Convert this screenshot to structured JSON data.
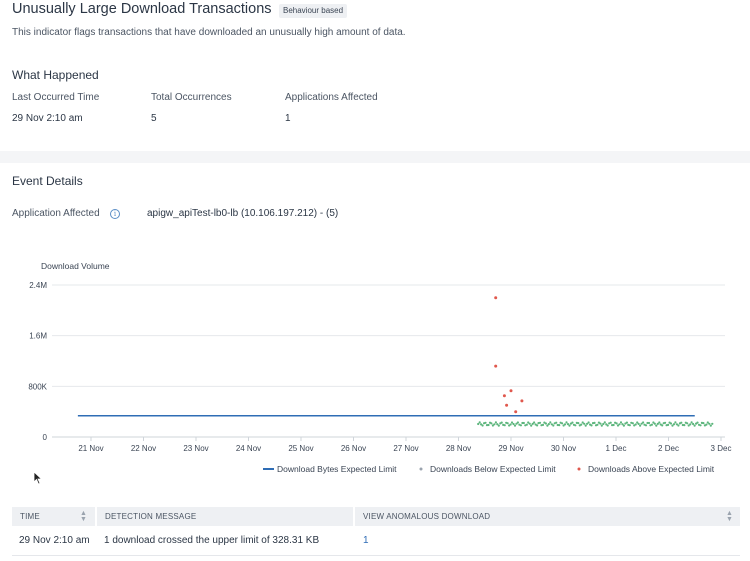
{
  "indicator": {
    "title": "Unusually Large Download Transactions",
    "badge": "Behaviour based",
    "description": "This indicator flags transactions that have downloaded an unusually high amount of data."
  },
  "what_happened": {
    "title": "What Happened",
    "stats": [
      {
        "label": "Last Occurred Time",
        "value": "29 Nov 2:10 am"
      },
      {
        "label": "Total Occurrences",
        "value": "5"
      },
      {
        "label": "Applications Affected",
        "value": "1"
      }
    ]
  },
  "event_details": {
    "title": "Event Details",
    "app_label": "Application Affected",
    "app_value": "apigw_apiTest-lb0-lb (10.106.197.212) - (5)"
  },
  "chart_data": {
    "type": "scatter",
    "ylabel": "Download Volume",
    "y_ticks": [
      "2.4M",
      "1.6M",
      "800K",
      "0"
    ],
    "y_tick_values": [
      2400000,
      1600000,
      800000,
      0
    ],
    "ylim": [
      0,
      2400000
    ],
    "x_ticks": [
      "21 Nov",
      "22 Nov",
      "23 Nov",
      "24 Nov",
      "25 Nov",
      "26 Nov",
      "27 Nov",
      "28 Nov",
      "29 Nov",
      "30 Nov",
      "1 Dec",
      "2 Dec",
      "3 Dec"
    ],
    "grid": true,
    "legend_position": "bottom-right",
    "colors": {
      "limit": "#2f6db5",
      "below": "#5cb57c",
      "above": "#e0584d"
    },
    "series": [
      {
        "name": "Download Bytes Expected Limit",
        "kind": "line",
        "x_start": "20 Nov 18:00",
        "x_end": "2 Dec 12:00",
        "value": 336200
      },
      {
        "name": "Downloads Below Expected Limit",
        "kind": "scatter",
        "x_start": "28 Nov 09:00",
        "x_end": "2 Dec 20:00",
        "value_range": [
          180000,
          230000
        ],
        "count": 160
      },
      {
        "name": "Downloads Above Expected Limit",
        "kind": "scatter",
        "points": [
          {
            "x": "28 Nov 17:00",
            "y": 2200000
          },
          {
            "x": "28 Nov 17:00",
            "y": 1120000
          },
          {
            "x": "28 Nov 21:00",
            "y": 650000
          },
          {
            "x": "28 Nov 22:00",
            "y": 500000
          },
          {
            "x": "29 Nov 00:00",
            "y": 730000
          },
          {
            "x": "29 Nov 02:10",
            "y": 400000
          },
          {
            "x": "29 Nov 05:00",
            "y": 570000
          }
        ]
      }
    ]
  },
  "table": {
    "columns": [
      "TIME",
      "DETECTION MESSAGE",
      "VIEW ANOMALOUS DOWNLOAD"
    ],
    "rows": [
      {
        "time": "29 Nov 2:10 am",
        "message": "1 download crossed the upper limit of 328.31 KB",
        "view": "1"
      }
    ]
  },
  "icons": {
    "info": "info-icon",
    "sort": "sort-icon",
    "cursor": "mouse-cursor-icon"
  }
}
